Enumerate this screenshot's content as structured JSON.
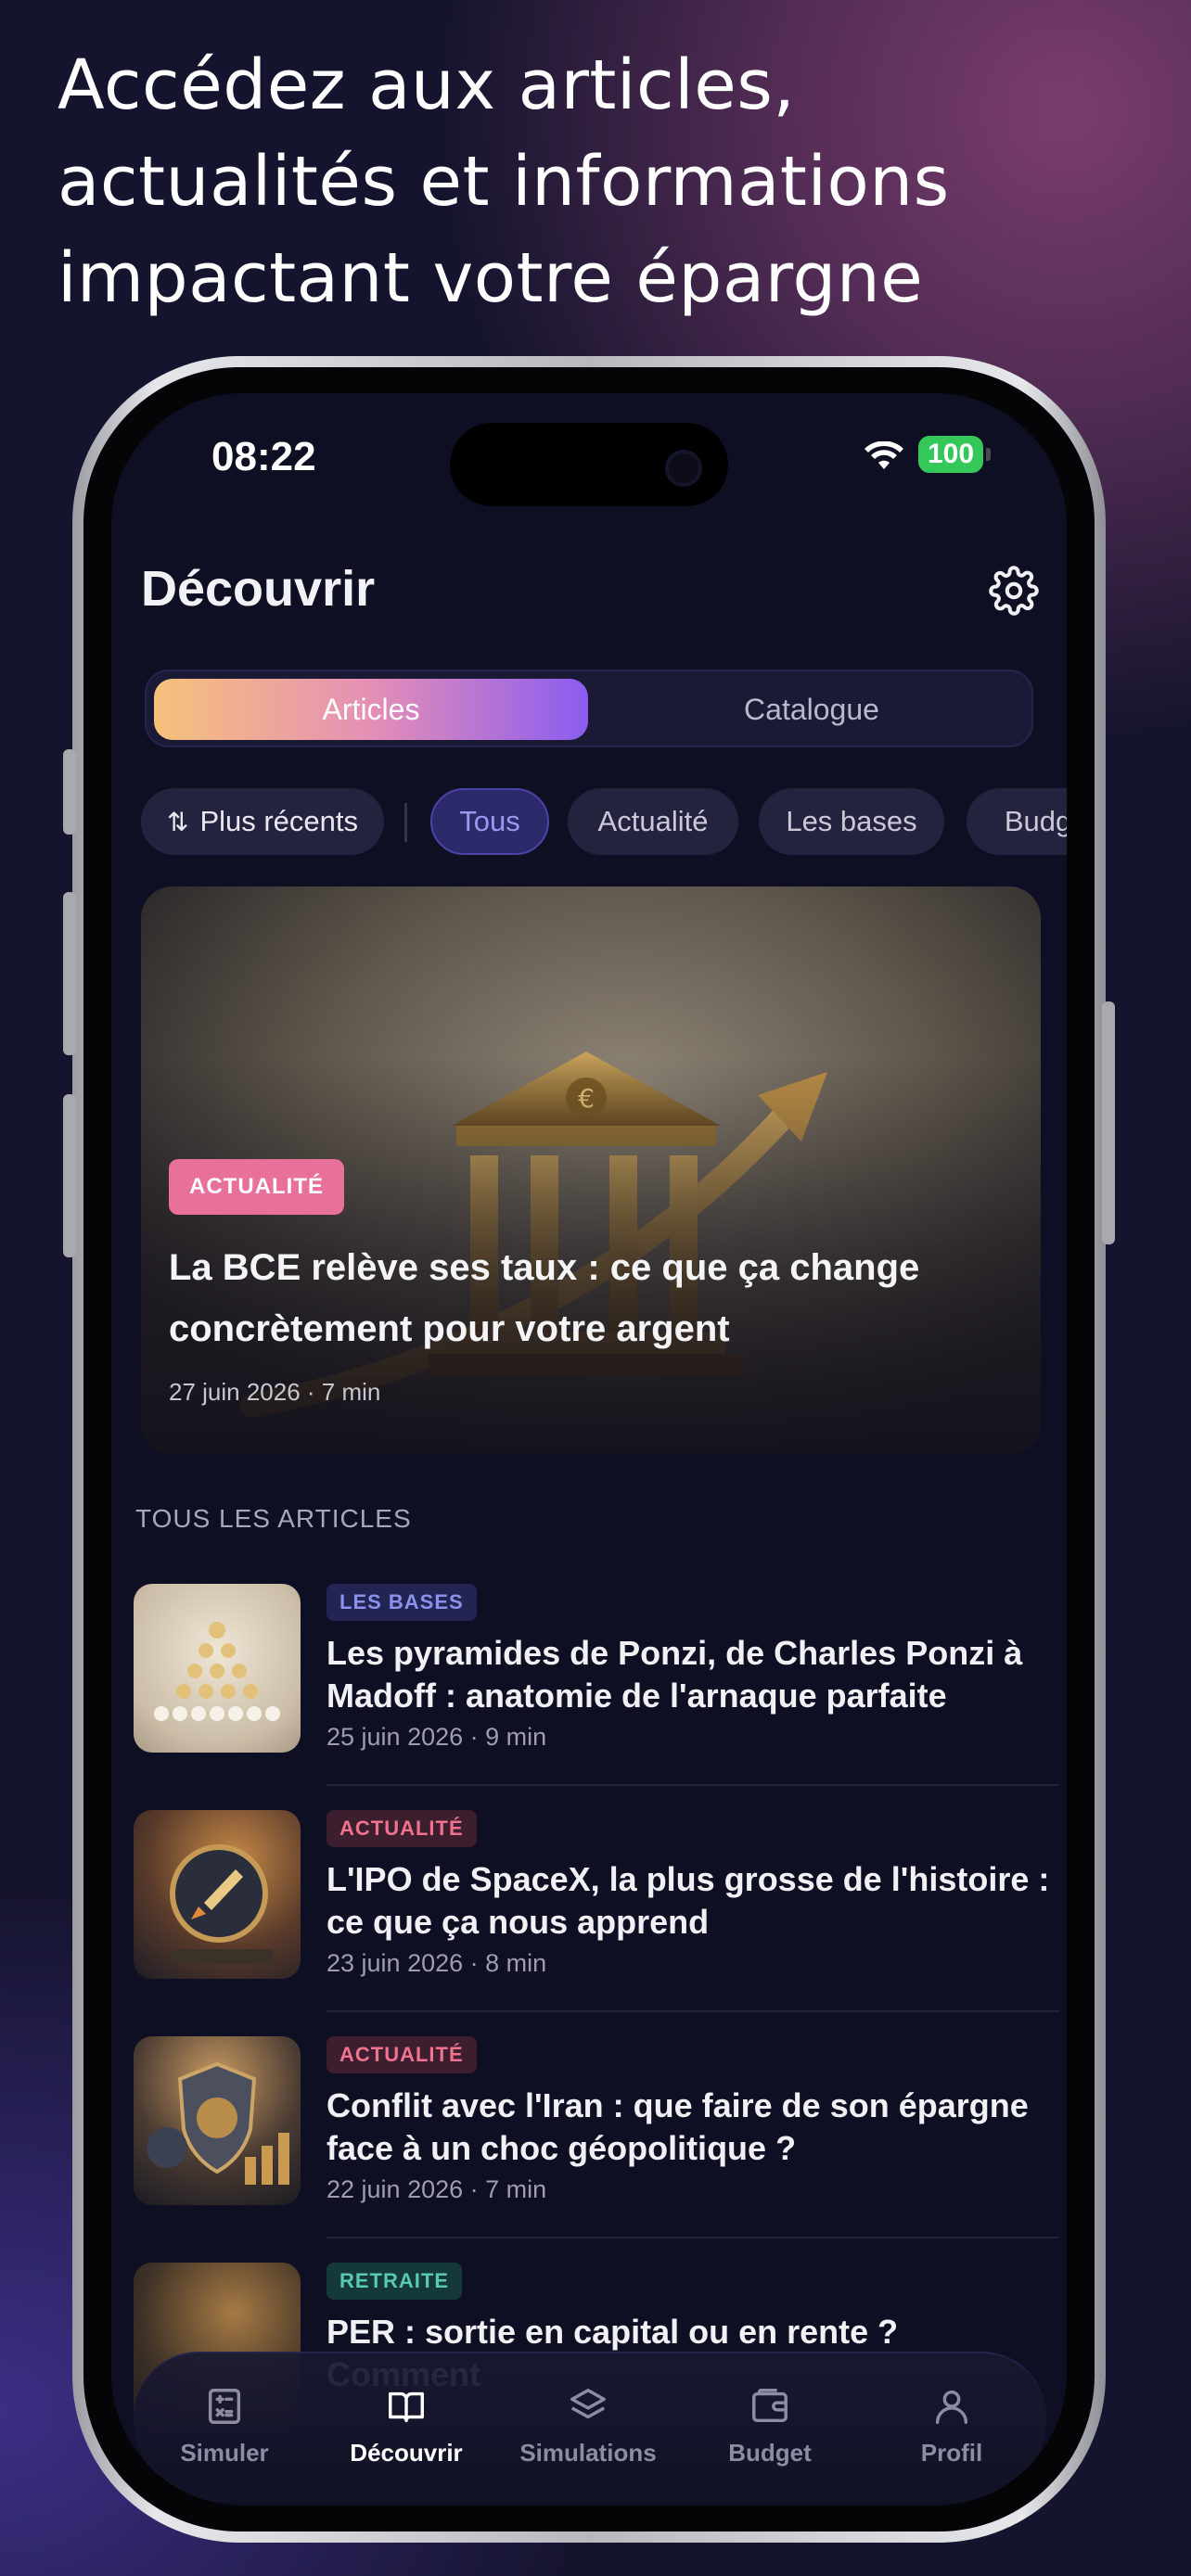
{
  "headline": {
    "line1": "Accédez aux articles,",
    "line2": "actualités et informations",
    "line3": "impactant votre épargne"
  },
  "status": {
    "time": "08:22",
    "battery": "100"
  },
  "header": {
    "title": "Découvrir",
    "settings_icon": "gear-icon"
  },
  "segment": {
    "active": "Articles",
    "other": "Catalogue"
  },
  "filters": {
    "sort": "Plus récents",
    "chips": [
      "Tous",
      "Actualité",
      "Les bases",
      "Budget"
    ],
    "selected": "Tous"
  },
  "featured": {
    "badge": "ACTUALITÉ",
    "title": "La BCE relève ses taux : ce que ça change concrètement pour votre argent",
    "meta": "27 juin 2026 · 7 min"
  },
  "section_label": "TOUS LES ARTICLES",
  "articles": [
    {
      "badge": "LES BASES",
      "title": "Les pyramides de Ponzi, de Charles Ponzi à Madoff : anatomie de l'arnaque parfaite",
      "meta": "25 juin 2026 · 9 min"
    },
    {
      "badge": "ACTUALITÉ",
      "title": "L'IPO de SpaceX, la plus grosse de l'histoire : ce que ça nous apprend",
      "meta": "23 juin 2026 · 8 min"
    },
    {
      "badge": "ACTUALITÉ",
      "title": "Conflit avec l'Iran : que faire de son épargne face à un choc géopolitique ?",
      "meta": "22 juin 2026 · 7 min"
    },
    {
      "badge": "RETRAITE",
      "title": "PER : sortie en capital ou en rente ? Comment",
      "meta": ""
    }
  ],
  "tabbar": [
    {
      "label": "Simuler",
      "icon": "calculator-icon"
    },
    {
      "label": "Découvrir",
      "icon": "open-book-icon"
    },
    {
      "label": "Simulations",
      "icon": "layers-icon"
    },
    {
      "label": "Budget",
      "icon": "wallet-icon"
    },
    {
      "label": "Profil",
      "icon": "user-icon"
    }
  ],
  "colors": {
    "background": "#15142e",
    "screen": "#0f0f24",
    "accent_gradient": [
      "#f6c27a",
      "#e58fb6",
      "#8a5cf0"
    ],
    "badge_actualite": "#e8709a",
    "badge_bases": "#8b90ee",
    "badge_retraite": "#57c9b4",
    "battery": "#34c759"
  }
}
